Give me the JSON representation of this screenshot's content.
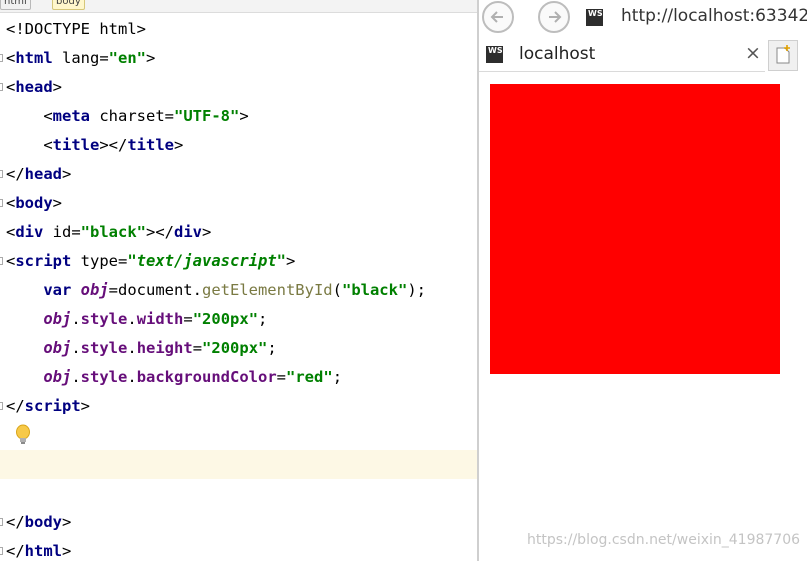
{
  "editor": {
    "breadcrumbs": [
      "html",
      "body"
    ],
    "lines": [
      {
        "segments": [
          {
            "t": "<!DOCTYPE html>",
            "c": "plain"
          }
        ]
      },
      {
        "segments": [
          {
            "t": "<",
            "c": "plain"
          },
          {
            "t": "html",
            "c": "tag"
          },
          {
            "t": " lang=",
            "c": "attr"
          },
          {
            "t": "\"en\"",
            "c": "str"
          },
          {
            "t": ">",
            "c": "plain"
          }
        ]
      },
      {
        "segments": [
          {
            "t": "<",
            "c": "plain"
          },
          {
            "t": "head",
            "c": "tag"
          },
          {
            "t": ">",
            "c": "plain"
          }
        ]
      },
      {
        "segments": [
          {
            "t": "    <",
            "c": "plain"
          },
          {
            "t": "meta",
            "c": "tag"
          },
          {
            "t": " charset=",
            "c": "attr"
          },
          {
            "t": "\"UTF-8\"",
            "c": "str"
          },
          {
            "t": ">",
            "c": "plain"
          }
        ]
      },
      {
        "segments": [
          {
            "t": "    <",
            "c": "plain"
          },
          {
            "t": "title",
            "c": "tag"
          },
          {
            "t": "></",
            "c": "plain"
          },
          {
            "t": "title",
            "c": "tag"
          },
          {
            "t": ">",
            "c": "plain"
          }
        ]
      },
      {
        "segments": [
          {
            "t": "</",
            "c": "plain"
          },
          {
            "t": "head",
            "c": "tag"
          },
          {
            "t": ">",
            "c": "plain"
          }
        ]
      },
      {
        "segments": [
          {
            "t": "<",
            "c": "plain"
          },
          {
            "t": "body",
            "c": "tag"
          },
          {
            "t": ">",
            "c": "plain"
          }
        ]
      },
      {
        "segments": [
          {
            "t": "<",
            "c": "plain"
          },
          {
            "t": "div",
            "c": "tag"
          },
          {
            "t": " id=",
            "c": "attr"
          },
          {
            "t": "\"black\"",
            "c": "str"
          },
          {
            "t": "></",
            "c": "plain"
          },
          {
            "t": "div",
            "c": "tag"
          },
          {
            "t": ">",
            "c": "plain"
          }
        ]
      },
      {
        "segments": [
          {
            "t": "<",
            "c": "plain"
          },
          {
            "t": "script",
            "c": "tag"
          },
          {
            "t": " type=",
            "c": "attr"
          },
          {
            "t": "\"text/javascript\"",
            "c": "str ital"
          },
          {
            "t": ">",
            "c": "plain"
          }
        ]
      },
      {
        "segments": [
          {
            "t": "    ",
            "c": "plain"
          },
          {
            "t": "var ",
            "c": "kw"
          },
          {
            "t": "obj",
            "c": "var"
          },
          {
            "t": "=document.",
            "c": "plain"
          },
          {
            "t": "getElementById",
            "c": "fn"
          },
          {
            "t": "(",
            "c": "plain"
          },
          {
            "t": "\"black\"",
            "c": "str"
          },
          {
            "t": ");",
            "c": "plain"
          }
        ]
      },
      {
        "segments": [
          {
            "t": "    ",
            "c": "plain"
          },
          {
            "t": "obj",
            "c": "var"
          },
          {
            "t": ".",
            "c": "plain"
          },
          {
            "t": "style",
            "c": "prop"
          },
          {
            "t": ".",
            "c": "plain"
          },
          {
            "t": "width",
            "c": "prop"
          },
          {
            "t": "=",
            "c": "plain"
          },
          {
            "t": "\"200px\"",
            "c": "str"
          },
          {
            "t": ";",
            "c": "plain"
          }
        ]
      },
      {
        "segments": [
          {
            "t": "    ",
            "c": "plain"
          },
          {
            "t": "obj",
            "c": "var"
          },
          {
            "t": ".",
            "c": "plain"
          },
          {
            "t": "style",
            "c": "prop"
          },
          {
            "t": ".",
            "c": "plain"
          },
          {
            "t": "height",
            "c": "prop"
          },
          {
            "t": "=",
            "c": "plain"
          },
          {
            "t": "\"200px\"",
            "c": "str"
          },
          {
            "t": ";",
            "c": "plain"
          }
        ]
      },
      {
        "segments": [
          {
            "t": "    ",
            "c": "plain"
          },
          {
            "t": "obj",
            "c": "var"
          },
          {
            "t": ".",
            "c": "plain"
          },
          {
            "t": "style",
            "c": "prop"
          },
          {
            "t": ".",
            "c": "plain"
          },
          {
            "t": "backgroundColor",
            "c": "prop"
          },
          {
            "t": "=",
            "c": "plain"
          },
          {
            "t": "\"red\"",
            "c": "str"
          },
          {
            "t": ";",
            "c": "plain"
          }
        ]
      },
      {
        "segments": [
          {
            "t": "</",
            "c": "plain"
          },
          {
            "t": "script",
            "c": "tag"
          },
          {
            "t": ">",
            "c": "plain"
          }
        ]
      },
      {
        "segments": []
      },
      {
        "segments": [],
        "highlight": true
      },
      {
        "segments": []
      },
      {
        "segments": [
          {
            "t": "</",
            "c": "plain"
          },
          {
            "t": "body",
            "c": "tag"
          },
          {
            "t": ">",
            "c": "plain"
          }
        ]
      },
      {
        "segments": [
          {
            "t": "</",
            "c": "plain"
          },
          {
            "t": "html",
            "c": "tag"
          },
          {
            "t": ">",
            "c": "plain"
          }
        ]
      }
    ],
    "gutter_marks": [
      1,
      2,
      5,
      6,
      8,
      13,
      17,
      18
    ]
  },
  "browser": {
    "url": "http://localhost:63342",
    "tab_title": "localhost",
    "site_icon_text": "WS",
    "close_glyph": "×",
    "box_color": "#ff0000"
  },
  "watermark": "https://blog.csdn.net/weixin_41987706"
}
